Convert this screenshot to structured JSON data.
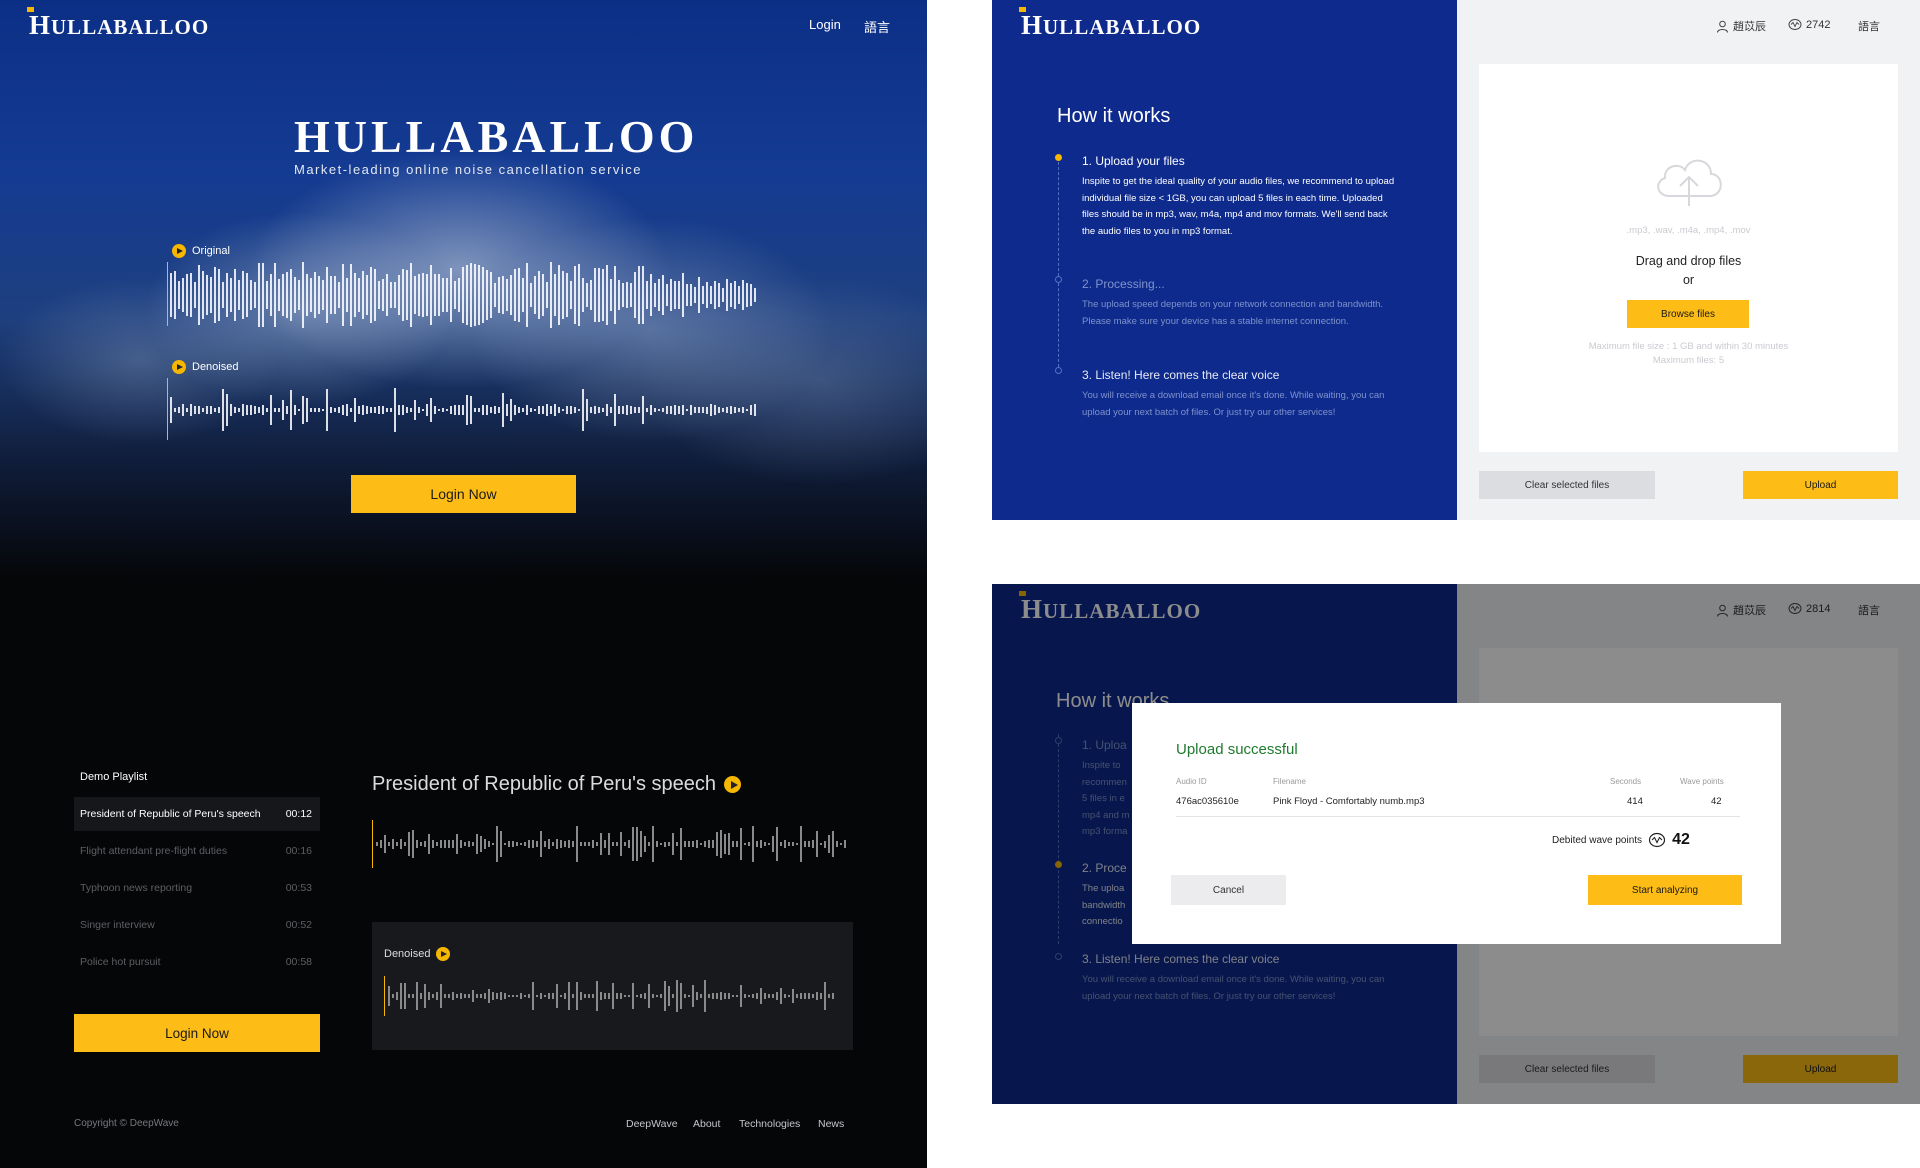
{
  "left": {
    "logo": {
      "initial": "H",
      "rest": "ULLABALLOO"
    },
    "nav": {
      "login": "Login",
      "language": "語言"
    },
    "hero": {
      "title": "HULLABALLOO",
      "subtitle": "Market-leading online noise cancellation service"
    },
    "original_label": "Original",
    "denoised_label": "Denoised",
    "login_now": "Login Now",
    "playlist": {
      "title": "Demo Playlist",
      "items": [
        {
          "name": "President of Republic of Peru's speech",
          "duration": "00:12"
        },
        {
          "name": "Flight attendant pre-flight duties",
          "duration": "00:16"
        },
        {
          "name": "Typhoon news reporting",
          "duration": "00:53"
        },
        {
          "name": "Singer interview",
          "duration": "00:52"
        },
        {
          "name": "Police hot pursuit",
          "duration": "00:58"
        }
      ],
      "active_index": 0
    },
    "speech_title": "President of Republic of Peru's speech",
    "speech_denoised_label": "Denoised",
    "login_now_bottom": "Login Now",
    "footer": {
      "copyright": "Copyright © DeepWave",
      "links": [
        "DeepWave",
        "About",
        "Technologies",
        "News"
      ]
    }
  },
  "top_right": {
    "logo": {
      "initial": "H",
      "rest": "ULLABALLOO"
    },
    "user": "趙苡辰",
    "points": "2742",
    "language": "語言",
    "how_it_works": "How it works",
    "steps": [
      {
        "title": "1. Upload your files",
        "text": "Inspite to get the ideal quality of your audio files, we recommend to upload individual file size < 1GB, you can upload 5 files in each time. Uploaded files should be in mp3, wav, m4a, mp4 and mov formats. We'll send back the audio files to you in mp3 format."
      },
      {
        "title": "2. Processing...",
        "text": "The upload speed depends on your network connection and bandwidth. Please make sure your device has a stable internet connection."
      },
      {
        "title": "3. Listen! Here comes the clear voice",
        "text": "You will receive a download email once it's done. While waiting, you can upload your next batch of files. Or just try our other services!"
      }
    ],
    "upload": {
      "formats": ".mp3, .wav, .m4a, .mp4, .mov",
      "drag_drop": "Drag and drop files",
      "or": "or",
      "browse": "Browse files",
      "max_size": "Maximum file size : 1 GB and within 30 minutes",
      "max_files": "Maximum files: 5"
    },
    "clear_button": "Clear selected files",
    "upload_button": "Upload"
  },
  "bottom_right": {
    "logo": {
      "initial": "H",
      "rest": "ULLABALLOO"
    },
    "user": "趙苡辰",
    "points": "2814",
    "language": "語言",
    "how_it_works": "How it works",
    "steps_visible": [
      {
        "title": "1. Uploa",
        "text_lines": [
          "Inspite to",
          "recommen",
          "5 files in e",
          "mp4 and m",
          "mp3 forma"
        ]
      },
      {
        "title": "2. Proce",
        "text_lines": [
          "The uploa",
          "bandwidth",
          "connectio"
        ]
      },
      {
        "title": "3. Listen! Here comes the clear voice",
        "text": "You will receive a download email once it's done. While waiting, you can upload your next batch of files. Or just try our other services!"
      }
    ],
    "clear_button": "Clear selected files",
    "upload_button": "Upload",
    "modal": {
      "title": "Upload successful",
      "headers": {
        "id": "Audio ID",
        "filename": "Filename",
        "seconds": "Seconds",
        "points": "Wave points"
      },
      "row": {
        "id": "476ac035610e",
        "filename": "Pink Floyd - Comfortably numb.mp3",
        "seconds": "414",
        "points": "42"
      },
      "debited_label": "Debited wave points",
      "debited_value": "42",
      "cancel": "Cancel",
      "start": "Start analyzing"
    }
  },
  "colors": {
    "accent_yellow": "#fdbc16",
    "brand_blue": "#0d2a8c",
    "success_green": "#1f7a2e"
  }
}
